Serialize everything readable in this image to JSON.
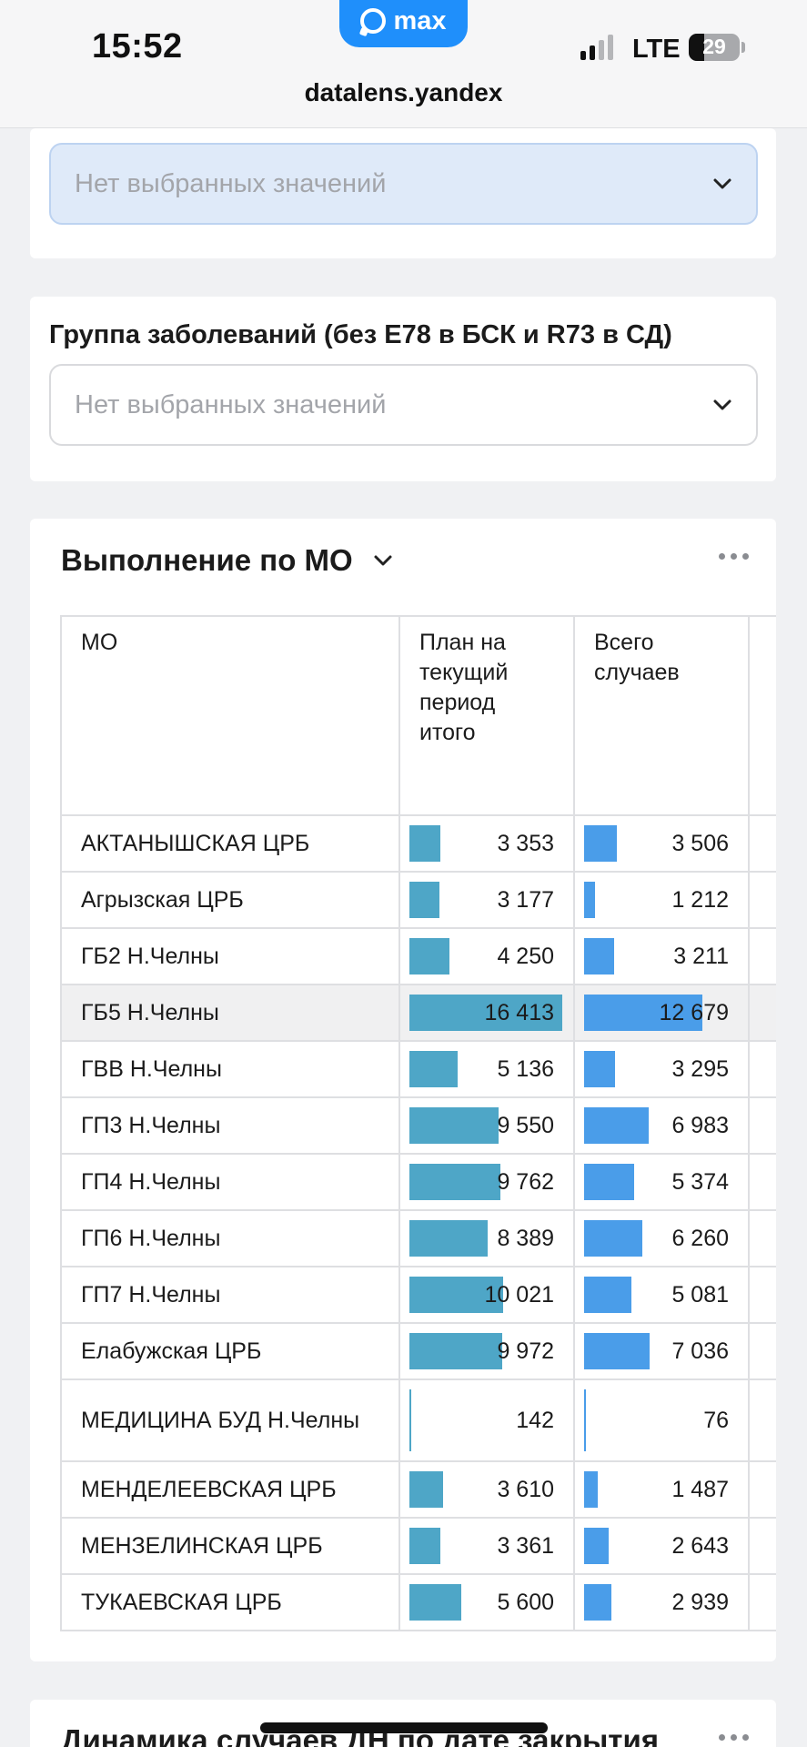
{
  "status_bar": {
    "time": "15:52",
    "app_badge": "max",
    "network": "LTE",
    "battery": "29",
    "url": "datalens.yandex"
  },
  "filter_top": {
    "placeholder": "Нет выбранных значений"
  },
  "filter_group": {
    "label": "Группа заболеваний (без Е78 в БСК и R73 в СД)",
    "placeholder": "Нет выбранных значений"
  },
  "widget": {
    "title": "Выполнение по МО",
    "columns": {
      "mo": "МО",
      "plan": "План на текущий период итого",
      "total": "Всего случаев"
    },
    "scale_max": 16413,
    "rows": [
      {
        "mo": "АКТАНЫШСКАЯ ЦРБ",
        "plan": "3 353",
        "plan_value": 3353,
        "total": "3 506",
        "total_value": 3506
      },
      {
        "mo": "Агрызская ЦРБ",
        "plan": "3 177",
        "plan_value": 3177,
        "total": "1 212",
        "total_value": 1212
      },
      {
        "mo": "ГБ2 Н.Челны",
        "plan": "4 250",
        "plan_value": 4250,
        "total": "3 211",
        "total_value": 3211
      },
      {
        "mo": "ГБ5 Н.Челны",
        "plan": "16 413",
        "plan_value": 16413,
        "total": "12 679",
        "total_value": 12679
      },
      {
        "mo": "ГВВ Н.Челны",
        "plan": "5 136",
        "plan_value": 5136,
        "total": "3 295",
        "total_value": 3295
      },
      {
        "mo": "ГП3 Н.Челны",
        "plan": "9 550",
        "plan_value": 9550,
        "total": "6 983",
        "total_value": 6983
      },
      {
        "mo": "ГП4 Н.Челны",
        "plan": "9 762",
        "plan_value": 9762,
        "total": "5 374",
        "total_value": 5374
      },
      {
        "mo": "ГП6 Н.Челны",
        "plan": "8 389",
        "plan_value": 8389,
        "total": "6 260",
        "total_value": 6260
      },
      {
        "mo": "ГП7 Н.Челны",
        "plan": "10 021",
        "plan_value": 10021,
        "total": "5 081",
        "total_value": 5081
      },
      {
        "mo": "Елабужская ЦРБ",
        "plan": "9 972",
        "plan_value": 9972,
        "total": "7 036",
        "total_value": 7036
      },
      {
        "mo": "МЕДИЦИНА БУД Н.Челны",
        "plan": "142",
        "plan_value": 142,
        "total": "76",
        "total_value": 76
      },
      {
        "mo": "МЕНДЕЛЕЕВСКАЯ ЦРБ",
        "plan": "3 610",
        "plan_value": 3610,
        "total": "1 487",
        "total_value": 1487
      },
      {
        "mo": "МЕНЗЕЛИНСКАЯ ЦРБ",
        "plan": "3 361",
        "plan_value": 3361,
        "total": "2 643",
        "total_value": 2643
      },
      {
        "mo": "ТУКАЕВСКАЯ ЦРБ",
        "plan": "5 600",
        "plan_value": 5600,
        "total": "2 939",
        "total_value": 2939
      }
    ]
  },
  "next_widget": {
    "title": "Динамика случаев ДН по дате закрытия"
  },
  "colors": {
    "plan_bar": "#4ea6c7",
    "total_bar": "#4a9de9",
    "brand": "#1f8ffb"
  }
}
